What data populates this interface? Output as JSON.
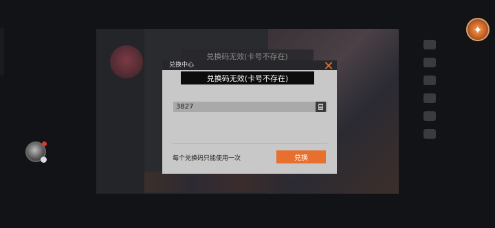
{
  "background": {
    "toast_text": "兑换码无效(卡号不存在)"
  },
  "dialog": {
    "title": "兑换中心",
    "close_icon": "close-icon",
    "toast_text": "兑换码无效(卡号不存在)",
    "code_value": "3827",
    "paste_icon": "paste-icon",
    "hint": "每个兑换码只能使用一次",
    "redeem_label": "兑换"
  },
  "colors": {
    "accent": "#e8702e",
    "dialog_bg": "#c8c8c8",
    "toast_bg": "#0c0c0d"
  }
}
